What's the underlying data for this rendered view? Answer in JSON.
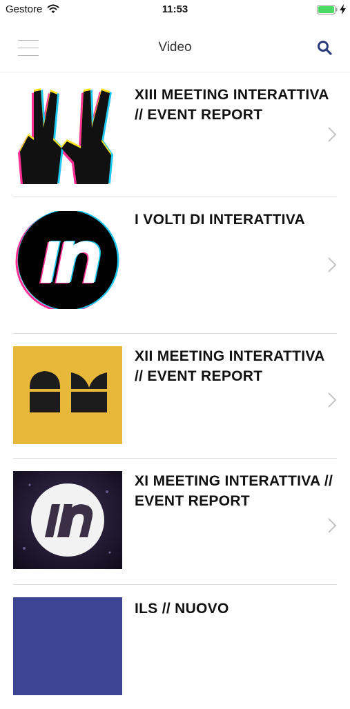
{
  "status_bar": {
    "carrier": "Gestore",
    "time": "11:53"
  },
  "nav": {
    "title": "Video",
    "menu_icon": "hamburger-menu-icon",
    "search_icon": "search-icon",
    "accent_color": "#2a3a7a"
  },
  "videos": [
    {
      "title": "XIII MEETING INTERATTIVA // EVENT REPORT",
      "thumbnail": "peace-hands-image"
    },
    {
      "title": "I VOLTI DI INTERATTIVA",
      "thumbnail": "in-logo-circle-black"
    },
    {
      "title": "XII MEETING INTERATTIVA // EVENT REPORT",
      "thumbnail": "arches-logo-yellow"
    },
    {
      "title": "XI MEETING INTERATTIVA // EVENT REPORT",
      "thumbnail": "in-logo-circle-white"
    },
    {
      "title": "ILS // NUOVO",
      "thumbnail": "blue-thumbnail"
    }
  ]
}
